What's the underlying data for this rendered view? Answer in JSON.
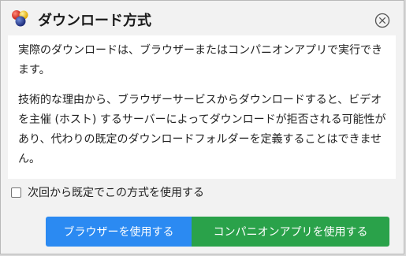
{
  "dialog": {
    "title": "ダウンロード方式",
    "paragraphs": [
      "実際のダウンロードは、ブラウザーまたはコンパニオンアプリで実行できます。",
      "技術的な理由から、ブラウザーサービスからダウンロードすると、ビデオを主催 (ホスト) するサーバーによってダウンロードが拒否される可能性があり、代わりの既定のダウンロードフォルダーを定義することはできません。"
    ],
    "remember_choice_label": "次回から既定でこの方式を使用する",
    "remember_choice_checked": false,
    "buttons": {
      "browser_label": "ブラウザーを使用する",
      "app_label": "コンパニオンアプリを使用する"
    }
  },
  "colors": {
    "browser_button": "#2b8af2",
    "app_button": "#2aa24a"
  },
  "icons": {
    "app": "colored-balls-icon",
    "close": "close-circle-icon"
  }
}
